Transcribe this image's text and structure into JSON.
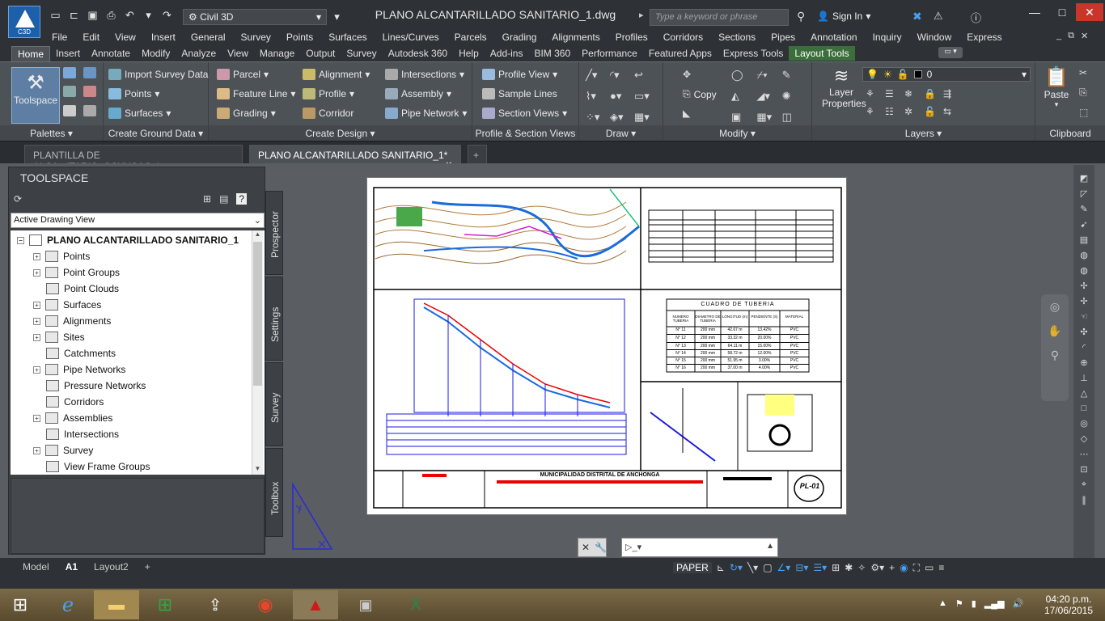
{
  "app": {
    "logo_label": "C3D",
    "workspace": "Civil 3D",
    "document_title": "PLANO ALCANTARILLADO SANITARIO_1.dwg",
    "search_placeholder": "Type a keyword or phrase",
    "sign_in": "Sign In",
    "win_minimize": "—",
    "win_restore": "□",
    "win_close": "✕"
  },
  "menubar": [
    "File",
    "Edit",
    "View",
    "Insert",
    "General",
    "Survey",
    "Points",
    "Surfaces",
    "Lines/Curves",
    "Parcels",
    "Grading",
    "Alignments",
    "Profiles",
    "Corridors",
    "Sections",
    "Pipes",
    "Annotation",
    "Inquiry",
    "Window",
    "Express"
  ],
  "ribbon_tabs": [
    {
      "label": "Home",
      "active": true
    },
    {
      "label": "Insert"
    },
    {
      "label": "Annotate"
    },
    {
      "label": "Modify"
    },
    {
      "label": "Analyze"
    },
    {
      "label": "View"
    },
    {
      "label": "Manage"
    },
    {
      "label": "Output"
    },
    {
      "label": "Survey"
    },
    {
      "label": "Autodesk 360"
    },
    {
      "label": "Help"
    },
    {
      "label": "Add-ins"
    },
    {
      "label": "BIM 360"
    },
    {
      "label": "Performance"
    },
    {
      "label": "Featured Apps"
    },
    {
      "label": "Express Tools"
    },
    {
      "label": "Layout Tools",
      "contextual": true
    }
  ],
  "ribbon": {
    "palettes": {
      "title": "Palettes",
      "toolspace": "Toolspace"
    },
    "ground": {
      "title": "Create Ground Data",
      "import": "Import Survey Data",
      "points": "Points",
      "surfaces": "Surfaces"
    },
    "design": {
      "title": "Create Design",
      "parcel": "Parcel",
      "feature_line": "Feature Line",
      "grading": "Grading",
      "alignment": "Alignment",
      "profile": "Profile",
      "corridor": "Corridor",
      "intersections": "Intersections",
      "assembly": "Assembly",
      "pipe_network": "Pipe Network"
    },
    "profile_section": {
      "title": "Profile & Section Views",
      "profile_view": "Profile View",
      "sample_lines": "Sample Lines",
      "section_views": "Section Views"
    },
    "draw": {
      "title": "Draw"
    },
    "modify": {
      "title": "Modify",
      "copy": "Copy"
    },
    "layers": {
      "title": "Layers",
      "properties": "Layer Properties",
      "current_layer": "0"
    },
    "clipboard": {
      "title": "Clipboard",
      "paste": "Paste"
    }
  },
  "doc_tabs": [
    {
      "label": "PLANTILLA DE ALCA...ITARIO_CCYHSAC.dwt",
      "active": false
    },
    {
      "label": "PLANO ALCANTARILLADO SANITARIO_1*",
      "active": true
    },
    {
      "label": "+"
    }
  ],
  "toolspace": {
    "title": "TOOLSPACE",
    "view_select": "Active Drawing View",
    "root": "PLANO ALCANTARILLADO SANITARIO_1",
    "items": [
      {
        "label": "Points",
        "expandable": true
      },
      {
        "label": "Point Groups",
        "expandable": true
      },
      {
        "label": "Point Clouds",
        "expandable": false
      },
      {
        "label": "Surfaces",
        "expandable": true
      },
      {
        "label": "Alignments",
        "expandable": true
      },
      {
        "label": "Sites",
        "expandable": true
      },
      {
        "label": "Catchments",
        "expandable": false
      },
      {
        "label": "Pipe Networks",
        "expandable": true
      },
      {
        "label": "Pressure Networks",
        "expandable": false
      },
      {
        "label": "Corridors",
        "expandable": false
      },
      {
        "label": "Assemblies",
        "expandable": true
      },
      {
        "label": "Intersections",
        "expandable": false
      },
      {
        "label": "Survey",
        "expandable": true
      },
      {
        "label": "View Frame Groups",
        "expandable": false
      }
    ],
    "side_tabs": [
      "Prospector",
      "Settings",
      "Survey",
      "Toolbox"
    ]
  },
  "drawing": {
    "pipe_table_title": "CUADRO DE TUBERIA",
    "pipe_table_headers": [
      "NUMERO TUBERIA",
      "DIAMETRO DE TUBERIA",
      "LONGITUD (m)",
      "PENDIENTE (S)",
      "MATERIAL"
    ],
    "pipe_table_rows": [
      [
        "N° 11",
        "200 mm",
        "42.67 m",
        "13.42%",
        "PVC"
      ],
      [
        "N° 12",
        "200 mm",
        "33.32 m",
        "20.00%",
        "PVC"
      ],
      [
        "N° 13",
        "200 mm",
        "64.11 m",
        "15.00%",
        "PVC"
      ],
      [
        "N° 14",
        "200 mm",
        "58.72 m",
        "12.00%",
        "PVC"
      ],
      [
        "N° 15",
        "200 mm",
        "51.95 m",
        "3.00%",
        "PVC"
      ],
      [
        "N° 16",
        "200 mm",
        "37.00 m",
        "4.00%",
        "PVC"
      ]
    ],
    "title_block": "MUNICIPALIDAD DISTRITAL DE ANCHONGA",
    "sheet_code": "PL-01"
  },
  "layout_tabs": [
    {
      "label": "Model"
    },
    {
      "label": "A1",
      "active": true
    },
    {
      "label": "Layout2"
    },
    {
      "label": "+"
    }
  ],
  "status": {
    "space": "PAPER"
  },
  "taskbar": {
    "time": "04:20 p.m.",
    "date": "17/06/2015"
  }
}
